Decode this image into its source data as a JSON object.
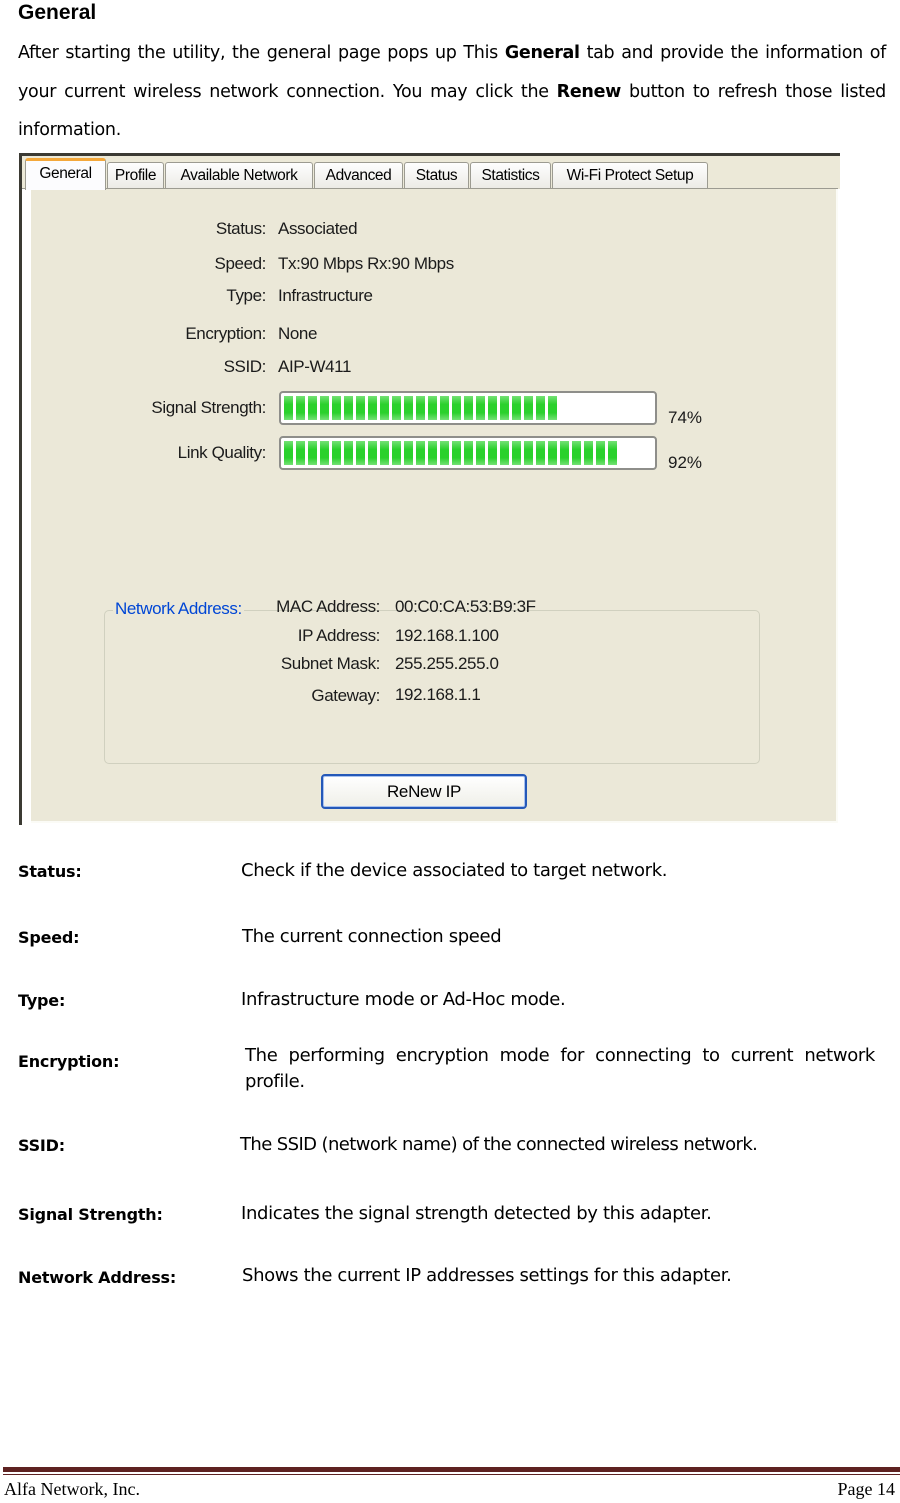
{
  "heading": "General",
  "intro": {
    "part1": "After starting the utility, the general page pops up This ",
    "bold1": "General",
    "part2": " tab and provide the information of your current wireless network connection. You may click the ",
    "bold2": "Renew",
    "part3": " button to refresh those listed information."
  },
  "utility": {
    "tabs": [
      {
        "label": "General",
        "active": true
      },
      {
        "label": "Profile",
        "active": false
      },
      {
        "label": "Available Network",
        "active": false
      },
      {
        "label": "Advanced",
        "active": false
      },
      {
        "label": "Status",
        "active": false
      },
      {
        "label": "Statistics",
        "active": false
      },
      {
        "label": "Wi-Fi Protect Setup",
        "active": false
      }
    ],
    "fields": {
      "status": {
        "label": "Status:",
        "value": "Associated"
      },
      "speed": {
        "label": "Speed:",
        "value": "Tx:90 Mbps Rx:90 Mbps"
      },
      "type": {
        "label": "Type:",
        "value": "Infrastructure"
      },
      "encryption": {
        "label": "Encryption:",
        "value": "None"
      },
      "ssid": {
        "label": "SSID:",
        "value": "AIP-W411"
      }
    },
    "signal_strength": {
      "label": "Signal Strength:",
      "percent": 74,
      "text": "74%"
    },
    "link_quality": {
      "label": "Link Quality:",
      "percent": 92,
      "text": "92%"
    },
    "network_address": {
      "title": "Network Address:",
      "mac": {
        "label": "MAC Address:",
        "value": "00:C0:CA:53:B9:3F"
      },
      "ip": {
        "label": "IP Address:",
        "value": "192.168.1.100"
      },
      "subnet": {
        "label": "Subnet Mask:",
        "value": "255.255.255.0"
      },
      "gateway": {
        "label": "Gateway:",
        "value": "192.168.1.1"
      }
    },
    "renew_button": "ReNew IP",
    "colors": {
      "bar_green": "#2ad12c",
      "group_title": "#0046d5",
      "active_tab_accent": "#f4a83b",
      "panel_bg": "#ebe8d8"
    }
  },
  "descriptions": [
    {
      "term": "Status:",
      "text": "Check if the device associated to target network."
    },
    {
      "term": "Speed:",
      "text": "The current connection speed"
    },
    {
      "term": "Type:",
      "text": "Infrastructure mode or Ad-Hoc mode."
    },
    {
      "term": "Encryption:",
      "text": "The performing encryption mode for connecting to current network profile."
    },
    {
      "term": "SSID:",
      "text": "The SSID (network name) of the connected wireless network."
    },
    {
      "term": "Signal Strength:",
      "text": "Indicates the signal strength detected by this adapter."
    },
    {
      "term": "Network Address:",
      "text": "Shows the current IP addresses settings for this adapter."
    }
  ],
  "footer": {
    "company": "Alfa Network, Inc.",
    "page": "Page 14",
    "rule_color": "#5e2221"
  }
}
